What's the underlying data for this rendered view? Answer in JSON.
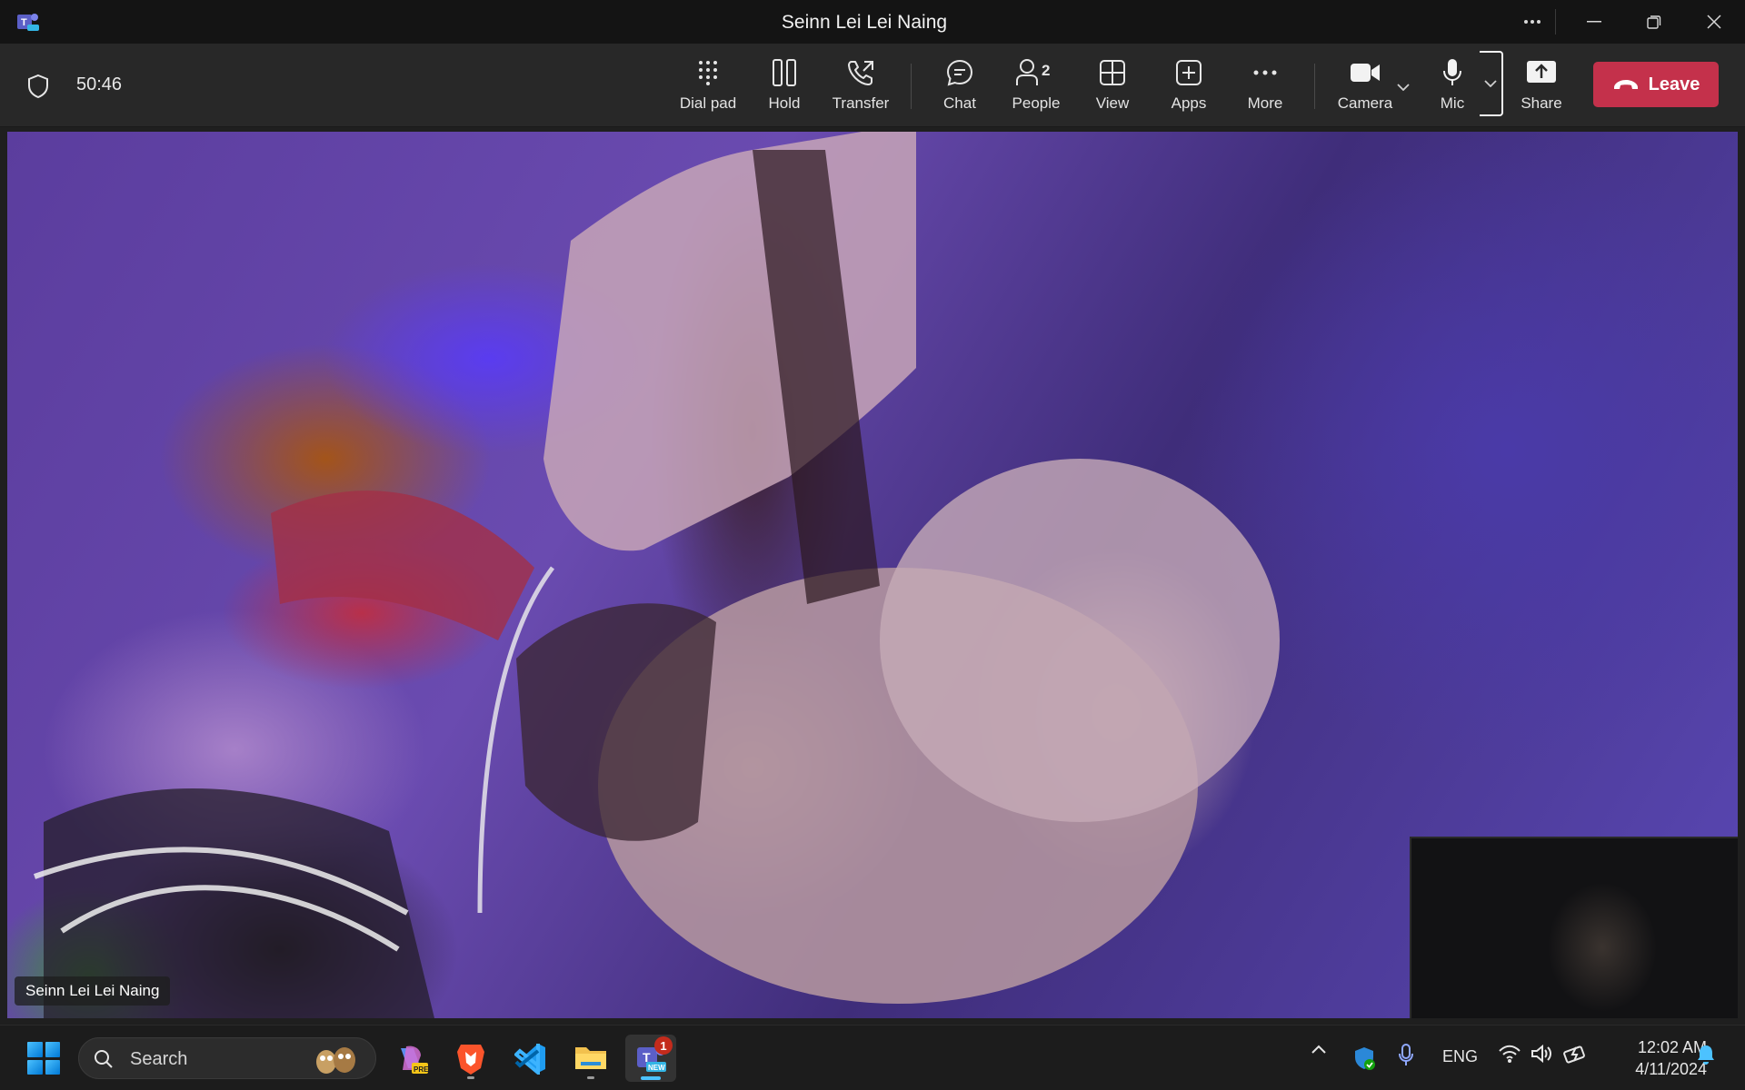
{
  "window": {
    "title": "Seinn Lei Lei Naing",
    "icons": {
      "app": "teams-icon",
      "more": "more-icon",
      "minimize": "minimize-icon",
      "restore": "restore-icon",
      "close": "close-icon"
    }
  },
  "toolbar": {
    "call_timer": "50:46",
    "buttons": {
      "dialpad": "Dial pad",
      "hold": "Hold",
      "transfer": "Transfer",
      "chat": "Chat",
      "people": "People",
      "people_count": "2",
      "view": "View",
      "apps": "Apps",
      "more": "More",
      "camera": "Camera",
      "mic": "Mic",
      "share": "Share",
      "leave": "Leave"
    },
    "leave_color": "#c4314b"
  },
  "stage": {
    "participant_name": "Seinn Lei Lei Naing"
  },
  "taskbar": {
    "search_placeholder": "Search",
    "apps": [
      "copilot-icon",
      "brave-icon",
      "vscode-icon",
      "file-explorer-icon",
      "teams-new-icon"
    ],
    "teams_badge": "1",
    "language": "ENG",
    "time": "12:02 AM",
    "date": "4/11/2024"
  }
}
